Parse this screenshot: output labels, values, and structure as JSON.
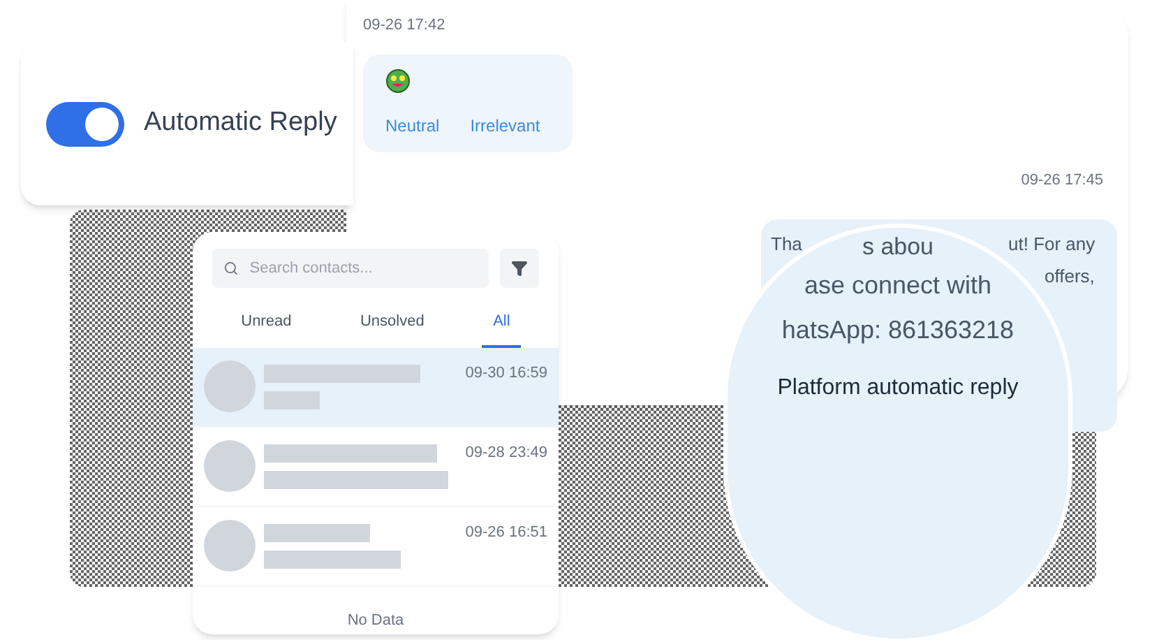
{
  "toggle": {
    "label": "Automatic Reply",
    "on": true
  },
  "chat": {
    "first_time": "09-26 17:42",
    "reaction_tags": [
      "Neutral",
      "Irrelevant"
    ],
    "second_time": "09-26 17:45",
    "bubble": {
      "line_1_start": "Tha",
      "line_1_end": "ut! For any",
      "line_2_end": "offers,",
      "magnified_top": "s abou",
      "magnified_line_2": "ase connect with",
      "magnified_line_3": "hatsApp: 861363218",
      "magnified_footer": "Platform automatic reply"
    }
  },
  "contacts": {
    "search": {
      "placeholder": "Search contacts..."
    },
    "tabs": [
      {
        "label": "Unread",
        "selected": false
      },
      {
        "label": "Unsolved",
        "selected": false
      },
      {
        "label": "All",
        "selected": true
      }
    ],
    "rows": [
      {
        "time": "09-30 16:59",
        "selected": true
      },
      {
        "time": "09-28 23:49",
        "selected": false
      },
      {
        "time": "09-26 16:51",
        "selected": false
      }
    ],
    "empty_text": "No Data"
  }
}
